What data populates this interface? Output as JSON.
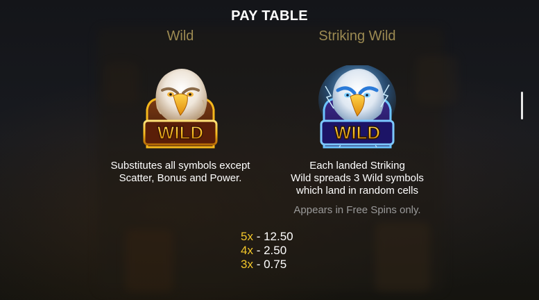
{
  "title": "PAY TABLE",
  "wild": {
    "heading": "Wild",
    "badge_text": "WILD",
    "icon": "eagle-wild-icon",
    "description_lines": [
      "Substitutes all symbols except",
      "Scatter, Bonus and Power."
    ]
  },
  "striking_wild": {
    "heading": "Striking Wild",
    "badge_text": "WILD",
    "icon": "lightning-eagle-wild-icon",
    "description_lines": [
      "Each landed Striking",
      "Wild spreads 3 Wild symbols",
      "which land in random cells"
    ],
    "note": "Appears in Free Spins only."
  },
  "payouts": [
    {
      "multiplier": "5x",
      "value": "12.50"
    },
    {
      "multiplier": "4x",
      "value": "2.50"
    },
    {
      "multiplier": "3x",
      "value": "0.75"
    }
  ],
  "colors": {
    "heading": "#9c8a52",
    "multiplier": "#f2c62a",
    "note": "#9a9a9a",
    "badge_gold": "#f5b81c",
    "striking_glow": "#5ab8ff"
  }
}
